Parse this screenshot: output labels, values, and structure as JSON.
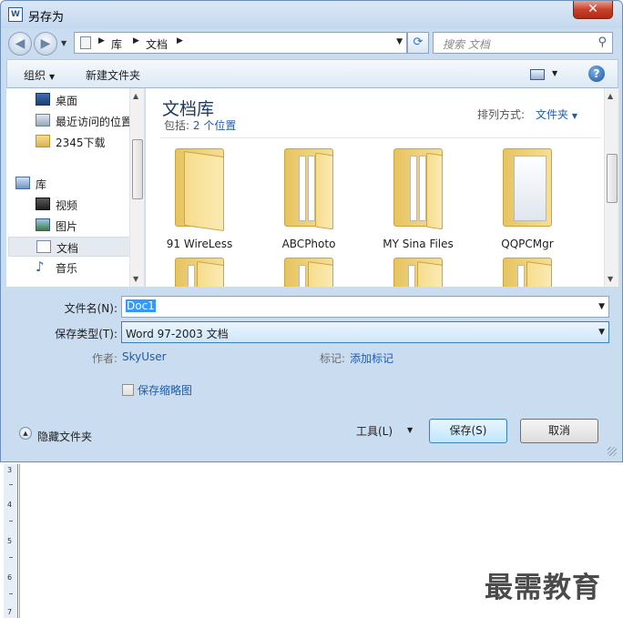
{
  "window": {
    "title": "另存为",
    "close_glyph": "✕",
    "app_icon_text": "W"
  },
  "nav": {
    "back_glyph": "◀",
    "forward_glyph": "▶",
    "breadcrumbs": [
      "库",
      "文档"
    ],
    "search_placeholder": "搜索 文档",
    "refresh_glyph": "⟳",
    "search_glyph": "⚲"
  },
  "toolbar": {
    "organize_label": "组织",
    "new_folder_label": "新建文件夹",
    "help_glyph": "?"
  },
  "sidebar": {
    "items": [
      {
        "label": "桌面",
        "icon": "desktop-icon",
        "selected": false
      },
      {
        "label": "最近访问的位置",
        "icon": "recent-places-icon",
        "selected": false
      },
      {
        "label": "2345下载",
        "icon": "folder-icon",
        "selected": false
      },
      {
        "label": "库",
        "icon": "libraries-icon",
        "selected": false
      },
      {
        "label": "视频",
        "icon": "video-icon",
        "selected": false
      },
      {
        "label": "图片",
        "icon": "pictures-icon",
        "selected": false
      },
      {
        "label": "文档",
        "icon": "documents-icon",
        "selected": true
      },
      {
        "label": "音乐",
        "icon": "music-icon",
        "selected": false
      }
    ]
  },
  "library": {
    "title": "文档库",
    "includes_label": "包括:",
    "includes_link": "2 个位置",
    "arrange_label": "排列方式:",
    "arrange_value": "文件夹"
  },
  "folders": [
    {
      "name": "91 WireLess"
    },
    {
      "name": "ABCPhoto"
    },
    {
      "name": "MY Sina Files"
    },
    {
      "name": "QQPCMgr"
    },
    {
      "name": ""
    },
    {
      "name": ""
    },
    {
      "name": ""
    },
    {
      "name": ""
    }
  ],
  "form": {
    "filename_label": "文件名(N):",
    "filename_value": "Doc1",
    "filetype_label": "保存类型(T):",
    "filetype_value": "Word 97-2003 文档",
    "author_label": "作者:",
    "author_value": "SkyUser",
    "tags_label": "标记:",
    "tags_value": "添加标记",
    "thumbnail_label": "保存缩略图",
    "thumbnail_checked": false
  },
  "footer": {
    "hide_folders_label": "隐藏文件夹",
    "tools_label": "工具(L)",
    "save_label": "保存(S)",
    "cancel_label": "取消"
  },
  "ruler": {
    "numbers": [
      "3",
      "4",
      "5",
      "6",
      "7"
    ]
  },
  "watermark": "最需教育",
  "colors": {
    "accent": "#1f5ca9",
    "selection": "#3399ff",
    "frame": "#c9dcf0",
    "close": "#c7412b"
  }
}
